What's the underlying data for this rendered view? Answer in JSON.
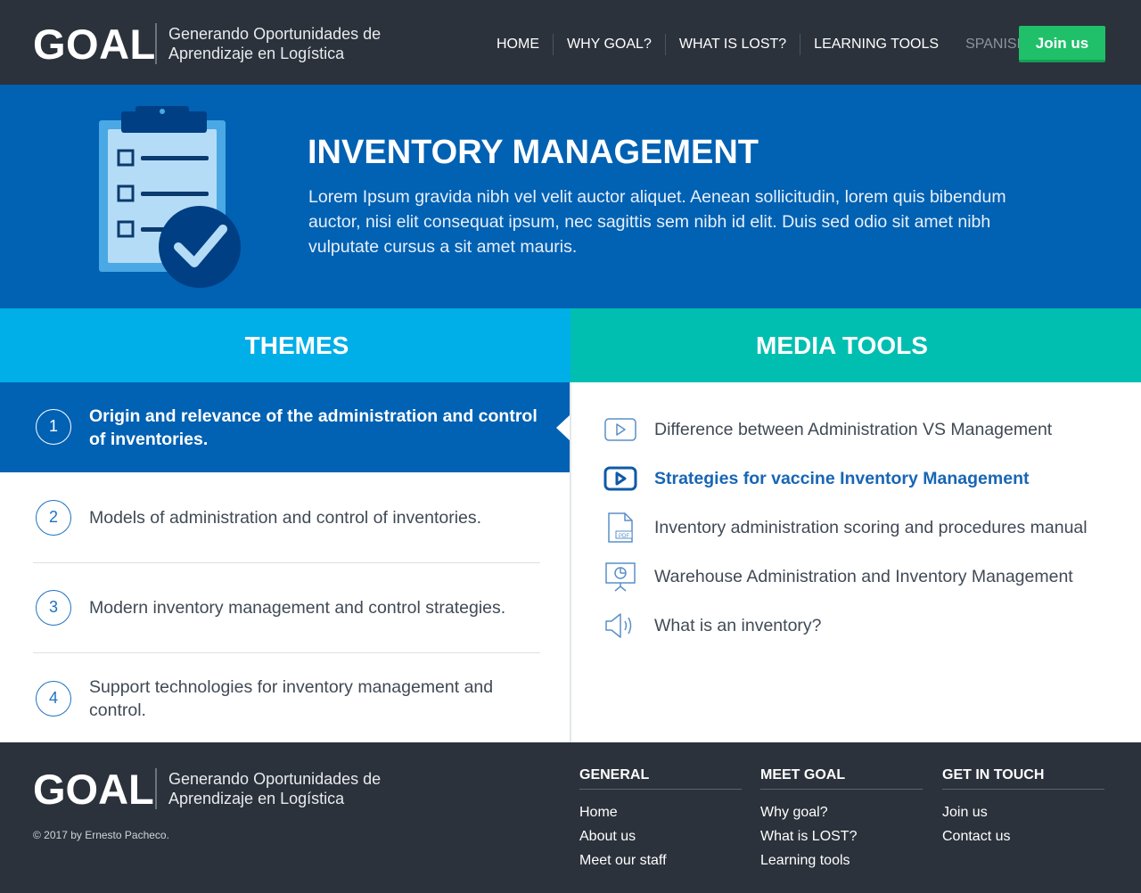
{
  "header": {
    "logo": "GOAL",
    "tagline": "Generando Oportunidades de Aprendizaje en Logística",
    "nav": [
      "HOME",
      "WHY GOAL?",
      "WHAT IS LOST?",
      "LEARNING TOOLS"
    ],
    "language": "SPANISH",
    "join_label": "Join us"
  },
  "hero": {
    "title": "INVENTORY MANAGEMENT",
    "text": "Lorem Ipsum gravida nibh vel velit auctor aliquet. Aenean sollicitudin, lorem quis bibendum auctor, nisi elit consequat ipsum, nec sagittis sem nibh id elit. Duis sed odio sit amet nibh vulputate cursus a sit amet mauris."
  },
  "themes": {
    "title": "THEMES",
    "items": [
      {
        "num": "1",
        "label": "Origin and relevance of the administration and control of inventories."
      },
      {
        "num": "2",
        "label": "Models of administration and control of inventories."
      },
      {
        "num": "3",
        "label": "Modern inventory management and control strategies."
      },
      {
        "num": "4",
        "label": "Support technologies for inventory management and control."
      }
    ]
  },
  "media": {
    "title": "MEDIA TOOLS",
    "items": [
      {
        "icon": "video-icon",
        "label": "Difference between Administration VS Management"
      },
      {
        "icon": "video-icon",
        "label": "Strategies for vaccine Inventory Management"
      },
      {
        "icon": "pdf-icon",
        "label": "Inventory administration scoring and procedures manual"
      },
      {
        "icon": "presentation-icon",
        "label": "Warehouse Administration and Inventory Management"
      },
      {
        "icon": "audio-icon",
        "label": "What is an inventory?"
      }
    ]
  },
  "footer": {
    "logo": "GOAL",
    "tagline": "Generando Oportunidades de Aprendizaje en Logística",
    "copyright": "© 2017 by Ernesto Pacheco.",
    "general": {
      "title": "GENERAL",
      "links": [
        "Home",
        "About us",
        "Meet our staff"
      ]
    },
    "meet": {
      "title": "MEET GOAL",
      "links": [
        "Why goal?",
        "What is LOST?",
        "Learning tools"
      ]
    },
    "contact": {
      "title": "GET IN TOUCH",
      "links": [
        "Join us",
        "Contact us"
      ]
    }
  },
  "colors": {
    "header_bg": "#2b323b",
    "hero_bg": "#0161b3",
    "themes_head": "#00aee8",
    "media_head": "#00bfb0",
    "join_button": "#1fc069",
    "highlight_text": "#1866b4"
  }
}
